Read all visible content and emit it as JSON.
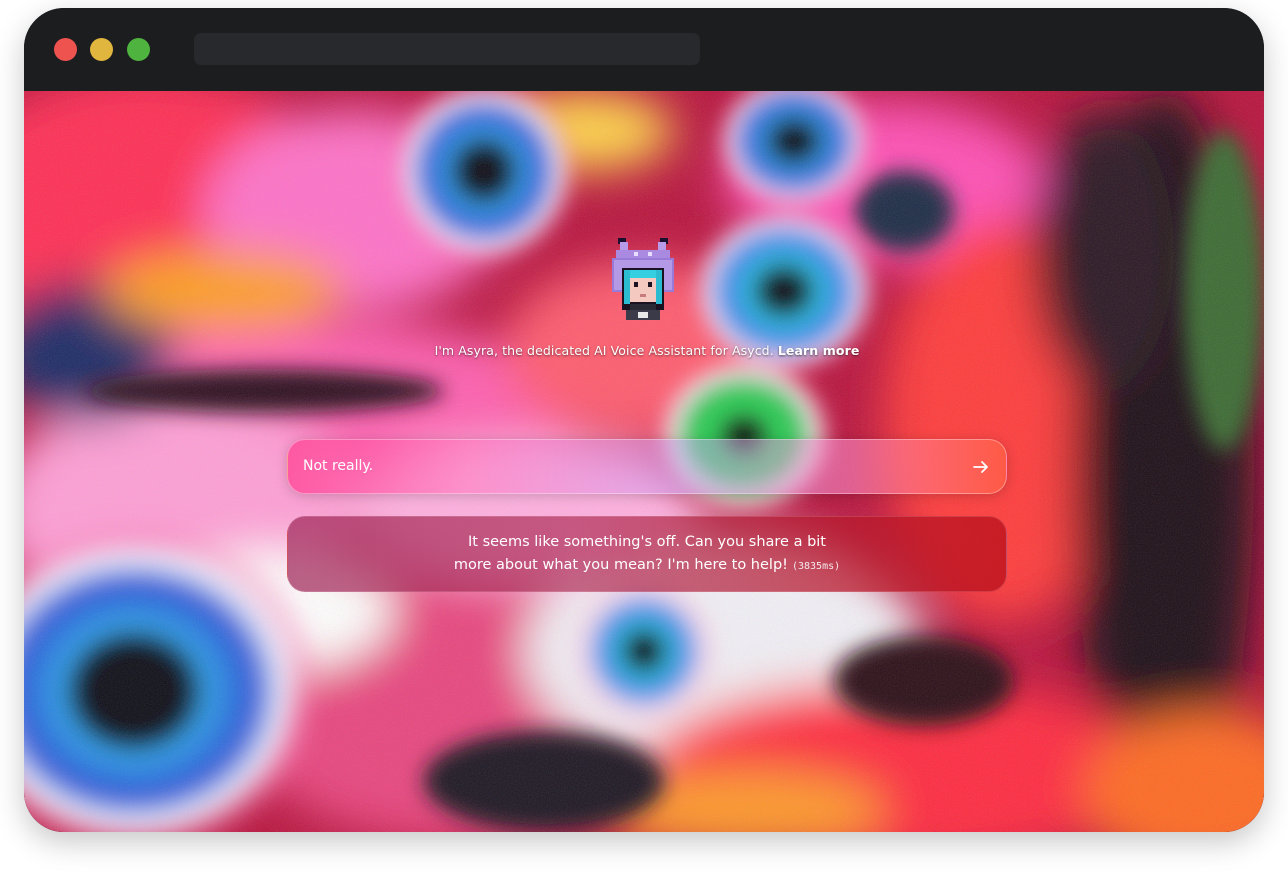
{
  "assistant": {
    "intro_text": "I'm Asyra, the dedicated AI Voice Assistant for Asycd.",
    "learn_more_label": "Learn more",
    "avatar_icon": "cat-helmet-avatar-icon"
  },
  "chat": {
    "input_value": "Not really.",
    "send_icon": "arrow-right-icon",
    "response_line1": "It seems like something's off. Can you share a bit",
    "response_line2": "more about what you mean? I'm here to help!",
    "response_time": "(3835ms)"
  },
  "colors": {
    "window_chrome": "#1c1d1f",
    "close_dot": "#ef5350",
    "minimize_dot": "#e1b63f",
    "maximize_dot": "#4fb33f"
  }
}
